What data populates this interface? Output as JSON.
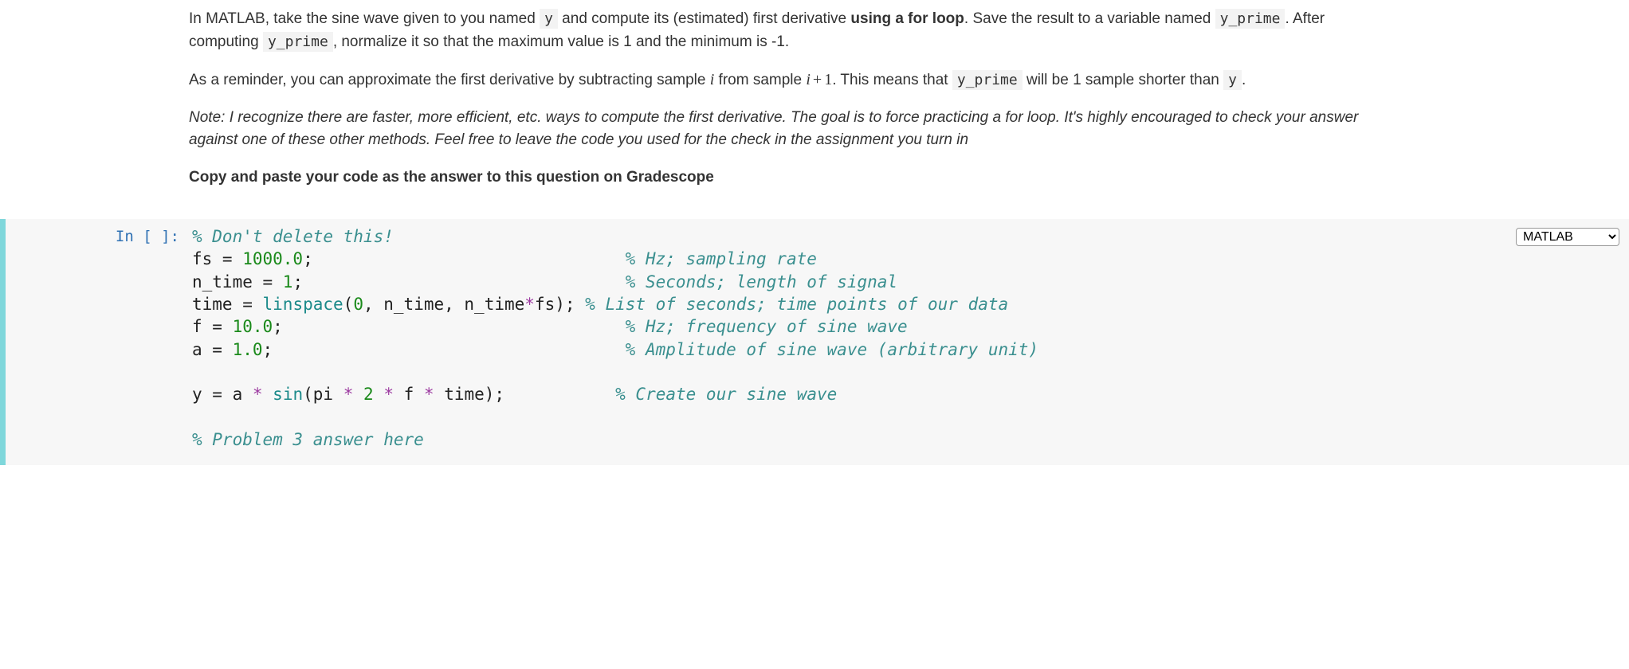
{
  "prose": {
    "p1_pre": "In MATLAB, take the sine wave given to you named ",
    "code_y": "y",
    "p1_mid1": " and compute its (estimated) first derivative ",
    "p1_bold": "using a for loop",
    "p1_mid2": ". Save the result to a variable named ",
    "code_yprime1": "y_prime",
    "p1_mid3": ". After computing ",
    "code_yprime2": "y_prime",
    "p1_end": ", normalize it so that the maximum value is 1 and the minimum is -1.",
    "p2_pre": "As a reminder, you can approximate the first derivative by subtracting sample ",
    "p2_i1": "i",
    "p2_mid1": " from sample ",
    "p2_i2": "i",
    "p2_plus": "+",
    "p2_one": "1",
    "p2_mid2": ". This means that ",
    "code_yprime3": "y_prime",
    "p2_mid3": " will be 1 sample shorter than ",
    "code_y2": "y",
    "p2_end": ".",
    "p3_note": "Note: I recognize there are faster, more efficient, etc. ways to compute the first derivative. The goal is to force practicing a for loop. It's highly encouraged to check your answer against one of these other methods. Feel free to leave the code you used for the check in the assignment you turn in",
    "p4_bold": "Copy and paste your code as the answer to this question on Gradescope"
  },
  "cell": {
    "prompt": "In [ ]:",
    "kernel_selected": "MATLAB",
    "kernel_options": [
      "MATLAB"
    ],
    "code": {
      "l1_comment": "% Don't delete this!",
      "l2a": "fs = ",
      "l2n": "1000.0",
      "l2b": ";                               ",
      "l2c": "% Hz; sampling rate",
      "l3a": "n_time = ",
      "l3n": "1",
      "l3b": ";                                ",
      "l3c": "% Seconds; length of signal",
      "l4a": "time = ",
      "l4f": "linspace",
      "l4b": "(",
      "l4n1": "0",
      "l4c": ", n_time, n_time",
      "l4op": "*",
      "l4d": "fs); ",
      "l4e": "% List of seconds; time points of our data",
      "l5a": "f = ",
      "l5n": "10.0",
      "l5b": ";                                  ",
      "l5c": "% Hz; frequency of sine wave",
      "l6a": "a = ",
      "l6n": "1.0",
      "l6b": ";                                   ",
      "l6c": "% Amplitude of sine wave (arbitrary unit)",
      "l7": "",
      "l8a": "y = a ",
      "l8op1": "*",
      "l8b": " ",
      "l8f": "sin",
      "l8c": "(pi ",
      "l8op2": "*",
      "l8d": " ",
      "l8n2": "2",
      "l8e": " ",
      "l8op3": "*",
      "l8g": " f ",
      "l8op4": "*",
      "l8h": " time);           ",
      "l8i": "% Create our sine wave",
      "l9": "",
      "l10": "% Problem 3 answer here"
    }
  }
}
